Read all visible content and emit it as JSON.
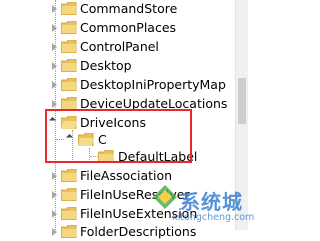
{
  "tree": {
    "items": [
      {
        "label": "CommandStore",
        "expanded": false
      },
      {
        "label": "CommonPlaces",
        "expanded": false
      },
      {
        "label": "ControlPanel",
        "expanded": false
      },
      {
        "label": "Desktop",
        "expanded": false
      },
      {
        "label": "DesktopIniPropertyMap",
        "expanded": false
      },
      {
        "label": "DeviceUpdateLocations",
        "expanded": false
      },
      {
        "label": "DriveIcons",
        "expanded": true
      },
      {
        "label": "C",
        "expanded": true
      },
      {
        "label": "DefaultLabel",
        "expanded": false
      },
      {
        "label": "FileAssociation",
        "expanded": false
      },
      {
        "label": "FileInUseResolver",
        "expanded": false
      },
      {
        "label": "FileInUseExtension",
        "expanded": false
      },
      {
        "label": "FolderDescriptions",
        "expanded": false
      }
    ]
  },
  "watermark": {
    "text": "系统城",
    "url": "xitongcheng.com"
  },
  "colors": {
    "highlight_border": "#e8282b",
    "folder": "#e9c25d",
    "watermark": "#3a7fcf"
  }
}
